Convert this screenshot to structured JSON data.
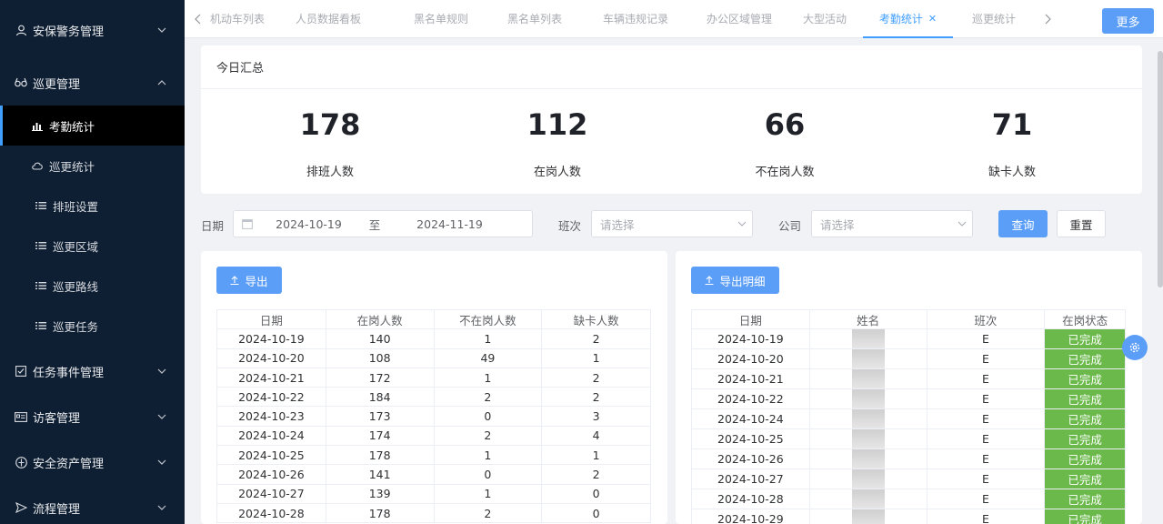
{
  "sidebar": {
    "groups": [
      {
        "label": "安保警务管理",
        "icon": "user-icon"
      },
      {
        "label": "巡更管理",
        "icon": "glasses-icon"
      },
      {
        "label": "任务事件管理",
        "icon": "checkbox-icon"
      },
      {
        "label": "访客管理",
        "icon": "id-card-icon"
      },
      {
        "label": "安全资产管理",
        "icon": "shield-icon"
      },
      {
        "label": "流程管理",
        "icon": "send-icon"
      }
    ],
    "sub_items": [
      {
        "label": "考勤统计",
        "icon": "bar-chart-icon"
      },
      {
        "label": "巡更统计",
        "icon": "cloud-icon"
      },
      {
        "label": "排班设置",
        "icon": "list-icon"
      },
      {
        "label": "巡更区域",
        "icon": "list-icon"
      },
      {
        "label": "巡更路线",
        "icon": "list-icon"
      },
      {
        "label": "巡更任务",
        "icon": "list-icon"
      }
    ]
  },
  "tabs": [
    "机动车列表",
    "人员数据看板",
    "黑名单规则",
    "黑名单列表",
    "车辆违规记录",
    "办公区域管理",
    "大型活动",
    "考勤统计",
    "巡更统计"
  ],
  "more_label": "更多",
  "summary": {
    "title": "今日汇总",
    "stats": [
      {
        "value": "178",
        "label": "排班人数"
      },
      {
        "value": "112",
        "label": "在岗人数"
      },
      {
        "value": "66",
        "label": "不在岗人数"
      },
      {
        "value": "71",
        "label": "缺卡人数"
      }
    ]
  },
  "filters": {
    "date_label": "日期",
    "date_start": "2024-10-19",
    "date_sep": "至",
    "date_end": "2024-11-19",
    "shift_label": "班次",
    "shift_placeholder": "请选择",
    "company_label": "公司",
    "company_placeholder": "请选择",
    "query_label": "查询",
    "reset_label": "重置"
  },
  "left_table": {
    "export_label": "导出",
    "columns": [
      "日期",
      "在岗人数",
      "不在岗人数",
      "缺卡人数"
    ],
    "rows": [
      [
        "2024-10-19",
        "140",
        "1",
        "2"
      ],
      [
        "2024-10-20",
        "108",
        "49",
        "1"
      ],
      [
        "2024-10-21",
        "172",
        "1",
        "2"
      ],
      [
        "2024-10-22",
        "184",
        "2",
        "2"
      ],
      [
        "2024-10-23",
        "173",
        "0",
        "3"
      ],
      [
        "2024-10-24",
        "174",
        "2",
        "4"
      ],
      [
        "2024-10-25",
        "178",
        "1",
        "1"
      ],
      [
        "2024-10-26",
        "141",
        "0",
        "2"
      ],
      [
        "2024-10-27",
        "139",
        "1",
        "0"
      ],
      [
        "2024-10-28",
        "178",
        "2",
        "0"
      ]
    ]
  },
  "right_table": {
    "export_label": "导出明细",
    "columns": [
      "日期",
      "姓名",
      "班次",
      "在岗状态"
    ],
    "rows": [
      [
        "2024-10-19",
        "",
        "E",
        "已完成"
      ],
      [
        "2024-10-20",
        "",
        "E",
        "已完成"
      ],
      [
        "2024-10-21",
        "",
        "E",
        "已完成"
      ],
      [
        "2024-10-22",
        "",
        "E",
        "已完成"
      ],
      [
        "2024-10-24",
        "",
        "E",
        "已完成"
      ],
      [
        "2024-10-25",
        "",
        "E",
        "已完成"
      ],
      [
        "2024-10-26",
        "",
        "E",
        "已完成"
      ],
      [
        "2024-10-27",
        "",
        "E",
        "已完成"
      ],
      [
        "2024-10-28",
        "",
        "E",
        "已完成"
      ],
      [
        "2024-10-29",
        "",
        "E",
        "已完成"
      ]
    ]
  },
  "colors": {
    "accent": "#409eff",
    "sidebar": "#0f1f33",
    "done": "#6ab94a"
  }
}
